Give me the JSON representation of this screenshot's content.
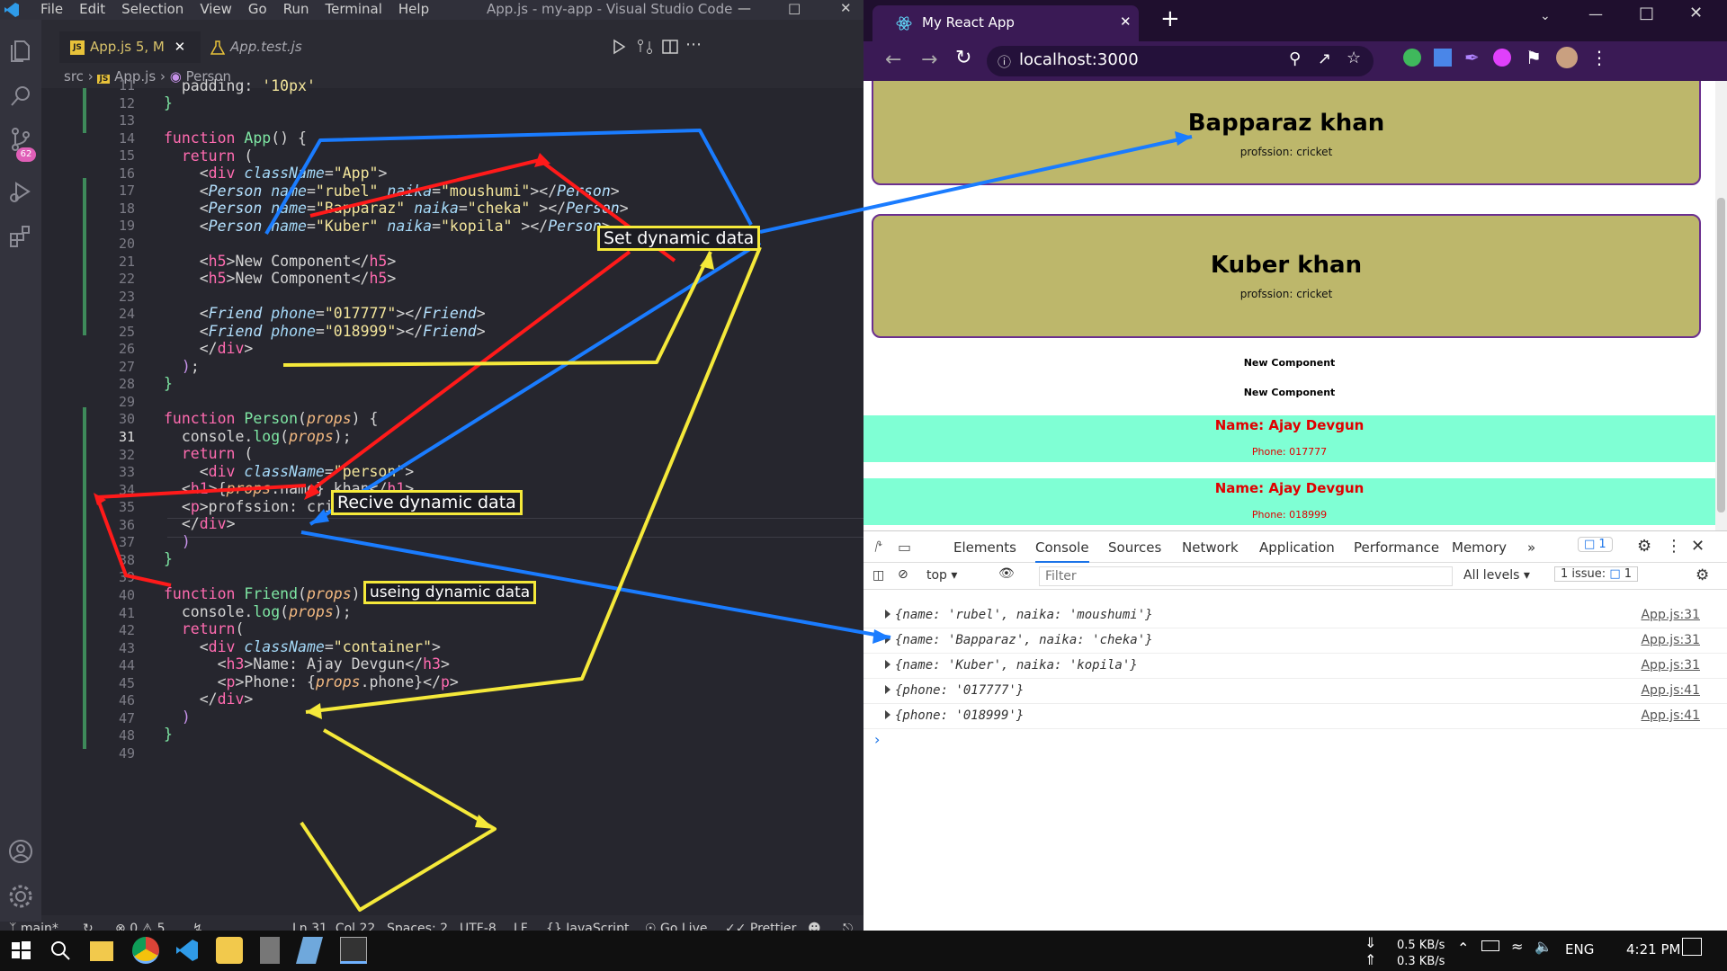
{
  "vscode": {
    "menu": [
      "File",
      "Edit",
      "Selection",
      "View",
      "Go",
      "Run",
      "Terminal",
      "Help"
    ],
    "window_title": "App.js - my-app - Visual Studio Code",
    "tabs": [
      {
        "label": "App.js",
        "suffix": "5, M"
      },
      {
        "label": "App.test.js"
      }
    ],
    "breadcrumb": [
      "src",
      "App.js",
      "Person"
    ],
    "scm_badge": "62",
    "line_numbers": [
      "11",
      "12",
      "13",
      "14",
      "15",
      "16",
      "17",
      "18",
      "19",
      "20",
      "21",
      "22",
      "23",
      "24",
      "25",
      "26",
      "27",
      "28",
      "29",
      "30",
      "31",
      "32",
      "33",
      "34",
      "35",
      "36",
      "37",
      "38",
      "39",
      "40",
      "41",
      "42",
      "43",
      "44",
      "45",
      "46",
      "47",
      "48",
      "49"
    ],
    "annotations": {
      "set": "Set dynamic data",
      "receive": "Recive dynamic data",
      "use": "useing dynamic data"
    },
    "status": {
      "branch": "main*",
      "problems": "0",
      "warnings": "5",
      "cursor": "Ln 31, Col 22",
      "spaces": "Spaces: 2",
      "encoding": "UTF-8",
      "eol": "LF",
      "language": "JavaScript",
      "golive": "Go Live",
      "prettier": "Prettier"
    }
  },
  "chrome": {
    "tab_title": "My React App",
    "url": "localhost:3000",
    "page": {
      "persons": [
        {
          "name": "Bapparaz khan",
          "profession": "profssion: cricket"
        },
        {
          "name": "Kuber khan",
          "profession": "profssion: cricket"
        }
      ],
      "headings": [
        "New Component",
        "New Component"
      ],
      "friends": [
        {
          "name": "Name: Ajay Devgun",
          "phone": "Phone: 017777"
        },
        {
          "name": "Name: Ajay Devgun",
          "phone": "Phone: 018999"
        }
      ]
    },
    "devtools": {
      "tabs": [
        "Elements",
        "Console",
        "Sources",
        "Network",
        "Application",
        "Performance",
        "Memory"
      ],
      "active_tab": "Console",
      "issue_count_top": "1",
      "context": "top",
      "filter_placeholder": "Filter",
      "levels": "All levels",
      "issues_label": "1 issue:",
      "issues_count": "1",
      "logs": [
        {
          "text": "{name: 'rubel', naika: 'moushumi'}",
          "source": "App.js:31"
        },
        {
          "text": "{name: 'Bapparaz', naika: 'cheka'}",
          "source": "App.js:31"
        },
        {
          "text": "{name: 'Kuber', naika: 'kopila'}",
          "source": "App.js:31"
        },
        {
          "text": "{phone: '017777'}",
          "source": "App.js:41"
        },
        {
          "text": "{phone: '018999'}",
          "source": "App.js:41"
        }
      ],
      "prompt": "›"
    }
  },
  "taskbar": {
    "net_down": "0.5 KB/s",
    "net_up": "0.3 KB/s",
    "language": "ENG",
    "time": "4:21 PM"
  },
  "colors": {
    "accent_red": "#ff1a1a",
    "accent_blue": "#1a7cff",
    "accent_yellow": "#f5e93a",
    "card_bg": "#bdb76b",
    "friend_bg": "#7fffd4"
  }
}
